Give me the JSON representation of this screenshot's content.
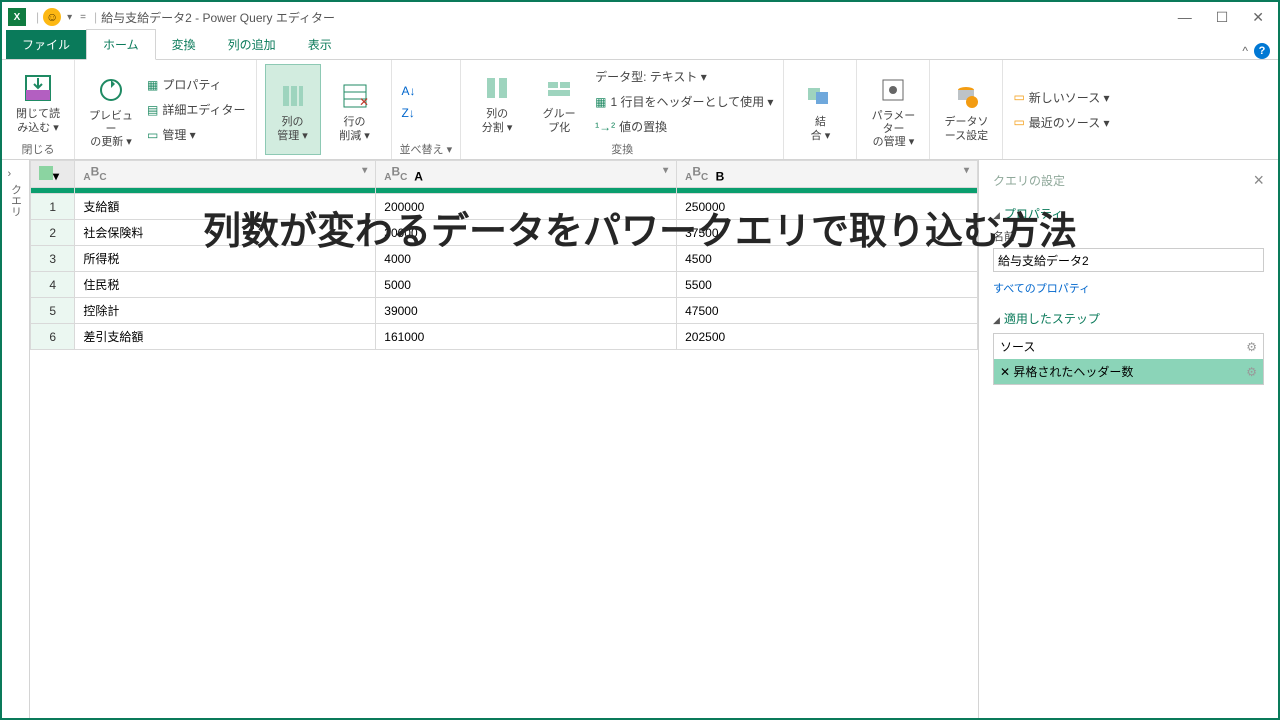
{
  "title": "給与支給データ2 - Power Query エディター",
  "overlay": "列数が変わるデータをパワークエリで取り込む方法",
  "tabs": {
    "file": "ファイル",
    "home": "ホーム",
    "transform": "変換",
    "addcol": "列の追加",
    "view": "表示"
  },
  "ribbon": {
    "close": {
      "label": "閉じて読\nみ込む ▾",
      "group": "閉じる"
    },
    "preview": {
      "label": "プレビュー\nの更新 ▾",
      "props": "プロパティ",
      "adv": "詳細エディター",
      "mgmt": "管理 ▾"
    },
    "cols": {
      "manage": "列の\n管理 ▾",
      "reduce": "行の\n削減 ▾"
    },
    "sort": {
      "asc": "A→Z",
      "desc": "Z→A",
      "group": "並べ替え ▾"
    },
    "split": {
      "label": "列の\n分割 ▾"
    },
    "grp": {
      "label": "グルー\nプ化"
    },
    "datatype": {
      "dt": "データ型: テキスト ▾",
      "hdr": "1 行目をヘッダーとして使用 ▾",
      "rep": "値の置換",
      "group": "変換"
    },
    "combine": {
      "label": "結\n合 ▾"
    },
    "param": {
      "label": "パラメーター\nの管理 ▾"
    },
    "ds": {
      "label": "データソ\nース設定"
    },
    "newsrc": "新しいソース ▾",
    "recentsrc": "最近のソース ▾"
  },
  "sidebar": {
    "label": "クエリ"
  },
  "grid": {
    "cols": [
      "",
      "A",
      "B"
    ],
    "rows": [
      {
        "n": "1",
        "c": [
          "支給額",
          "200000",
          "250000"
        ]
      },
      {
        "n": "2",
        "c": [
          "社会保険料",
          "30000",
          "37500"
        ]
      },
      {
        "n": "3",
        "c": [
          "所得税",
          "4000",
          "4500"
        ]
      },
      {
        "n": "4",
        "c": [
          "住民税",
          "5000",
          "5500"
        ]
      },
      {
        "n": "5",
        "c": [
          "控除計",
          "39000",
          "47500"
        ]
      },
      {
        "n": "6",
        "c": [
          "差引支給額",
          "161000",
          "202500"
        ]
      }
    ]
  },
  "settings": {
    "title": "クエリの設定",
    "props": "プロパティ",
    "name_label": "名前",
    "name_value": "給与支給データ2",
    "all_props": "すべてのプロパティ",
    "steps_h": "適用したステップ",
    "steps": [
      {
        "label": "ソース",
        "sel": false
      },
      {
        "label": "昇格されたヘッダー数",
        "sel": true,
        "del": true
      }
    ]
  }
}
